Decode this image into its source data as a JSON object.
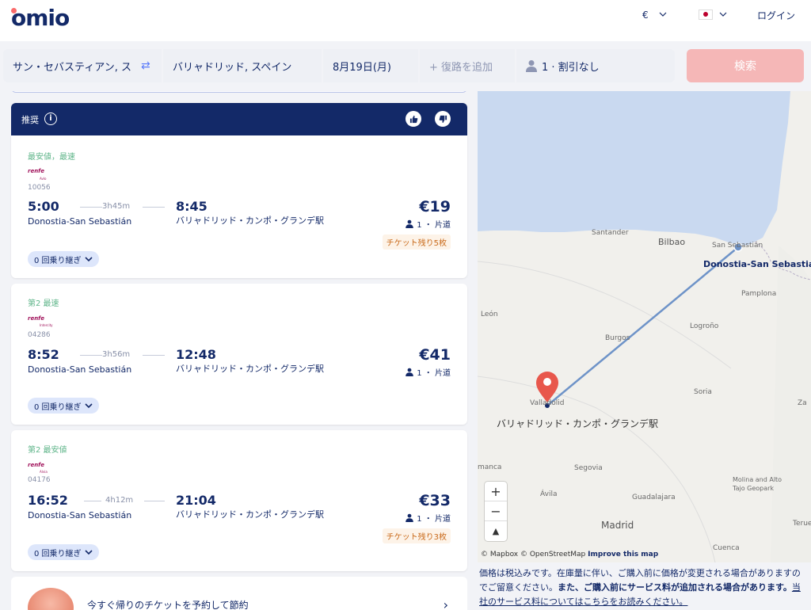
{
  "header": {
    "logo": "omio",
    "currency": "€",
    "login": "ログイン"
  },
  "search": {
    "from": "サン・セバスティアン, ス",
    "to": "バリャドリッド, スペイン",
    "date": "8月19日(月)",
    "return": "+ 復路を追加",
    "passengers": "1 · 割引なし",
    "button": "検索"
  },
  "results": {
    "recommended_label": "推奨",
    "cards": [
      {
        "tag": "最安値，最速",
        "operator": "renfe",
        "operator_sub": "Avlo",
        "train": "10056",
        "dep": "5:00",
        "duration": "3h45m",
        "arr": "8:45",
        "from_station": "Donostia-San Sebastián",
        "to_station": "バリャドリッド・カンポ・グランデ駅",
        "price": "€19",
        "pax": "1 ・ 片道",
        "seats_left": "チケット残り5枚",
        "stops": "0 回乗り継ぎ"
      },
      {
        "tag": "第2 最速",
        "operator": "renfe",
        "operator_sub": "Intercity",
        "train": "04286",
        "dep": "8:52",
        "duration": "3h56m",
        "arr": "12:48",
        "from_station": "Donostia-San Sebastián",
        "to_station": "バリャドリッド・カンポ・グランデ駅",
        "price": "€41",
        "pax": "1 ・ 片道",
        "seats_left": "",
        "stops": "0 回乗り継ぎ"
      },
      {
        "tag": "第2 最安値",
        "operator": "renfe",
        "operator_sub": "Alvia",
        "train": "04176",
        "dep": "16:52",
        "duration": "4h12m",
        "arr": "21:04",
        "from_station": "Donostia-San Sebastián",
        "to_station": "バリャドリッド・カンポ・グランデ駅",
        "price": "€33",
        "pax": "1 ・ 片道",
        "seats_left": "チケット残り3枚",
        "stops": "0 回乗り継ぎ"
      }
    ],
    "promo": "今すぐ帰りのチケットを予約して節約"
  },
  "map": {
    "labels": {
      "santander": "Santander",
      "bilbao": "Bilbao",
      "san_sebastian_small": "San Sebastián",
      "origin": "Donostia-San Sebastián",
      "pamplona": "Pamplona",
      "leon": "León",
      "logrono": "Logroño",
      "burgos": "Burgos",
      "valladolid": "Valladolid",
      "soria": "Soria",
      "za": "Za",
      "destination": "バリャドリッド・カンポ・グランデ駅",
      "salamanca": "manca",
      "segovia": "Segovia",
      "avila": "Ávila",
      "guadalajara": "Guadalajara",
      "madrid": "Madrid",
      "molina": "Molina and Alto Tajo Geopark",
      "teruel": "Terue",
      "cuenca": "Cuenca"
    },
    "attribution": "© Mapbox © OpenStreetMap",
    "improve": "Improve this map"
  },
  "footer": {
    "disclaimer_1": "価格は税込みです。在庫量に伴い、ご購入前に価格が変更される場合がありますのでご留意ください。",
    "disclaimer_bold": "また、ご購入前にサービス料が追加される場合があります。",
    "disclaimer_link": "当社のサービス料についてはこちらをお読みください。"
  },
  "colors": {
    "brand_navy": "#132968",
    "brand_red": "#fa6b6b",
    "route": "#6e93c8",
    "pin": "#e8574c",
    "sea": "#c9d9f0"
  }
}
